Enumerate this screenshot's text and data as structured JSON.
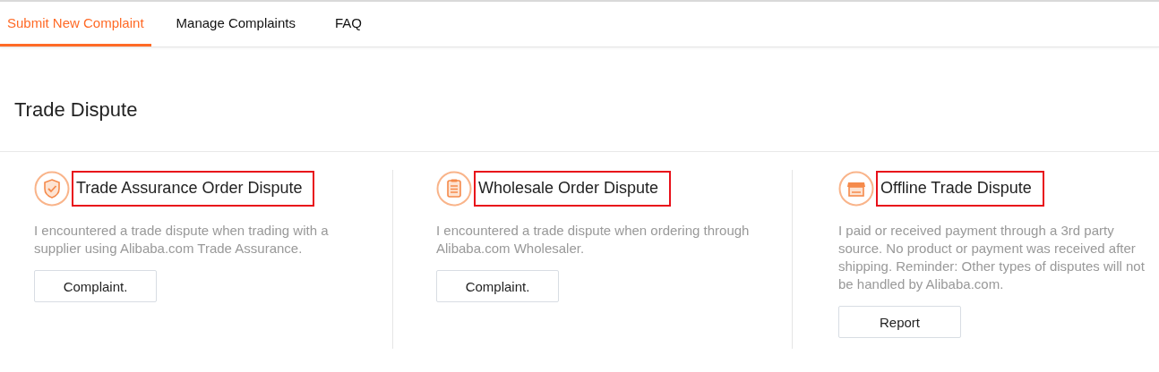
{
  "tabs": [
    {
      "label": "Submit New Complaint",
      "selected": true
    },
    {
      "label": "Manage Complaints",
      "selected": false
    },
    {
      "label": "FAQ",
      "selected": false
    }
  ],
  "section_title": "Trade Dispute",
  "cards": [
    {
      "kind": "shield",
      "title": "Trade Assurance Order Dispute",
      "highlighted": true,
      "description": "I encountered a trade dispute when trading with a supplier using Alibaba.com Trade Assurance.",
      "button": "Complaint."
    },
    {
      "kind": "clipboard",
      "title": "Wholesale Order Dispute",
      "highlighted": true,
      "description": "I encountered a trade dispute when ordering through Alibaba.com Wholesaler.",
      "button": "Complaint."
    },
    {
      "kind": "store",
      "title": "Offline Trade Dispute",
      "highlighted": true,
      "description": "I paid or received payment through a 3rd party source. No product or payment was received after shipping. Reminder: Other types of disputes will not be handled by Alibaba.com.",
      "button": "Report"
    }
  ]
}
